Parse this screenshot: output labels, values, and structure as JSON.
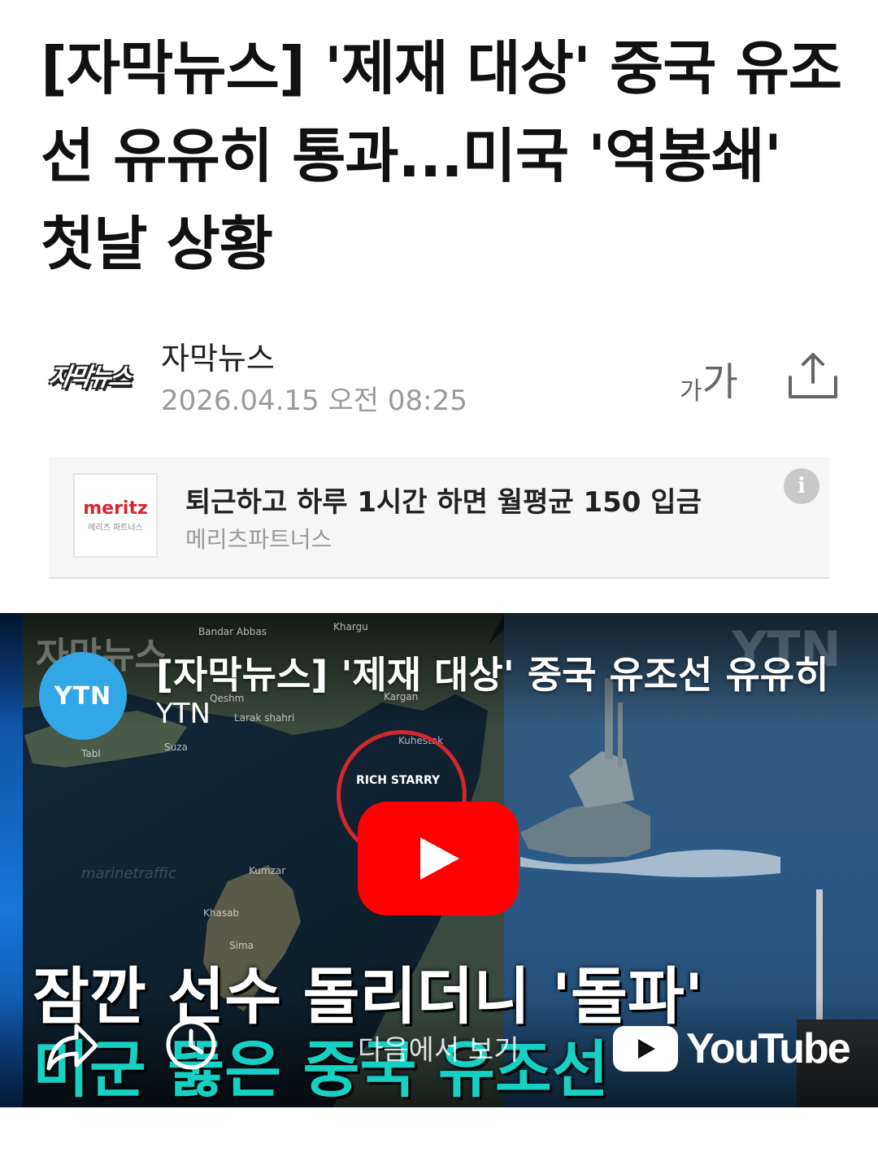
{
  "article": {
    "title": "[자막뉴스] '제재 대상' 중국 유조선 유유히 통과...미국 '역봉쇄' 첫날 상황"
  },
  "byline": {
    "press_logo": "자막뉴스",
    "press_name": "자막뉴스",
    "date": "2026.04.15 오전 08:25",
    "font_small": "가",
    "font_big": "가"
  },
  "ad": {
    "logo_main": "meritz",
    "logo_sub": "메리츠 파트너스",
    "title": "퇴근하고 하루 1시간 하면 월평균 150 입금",
    "sponsor": "메리츠파트너스",
    "info_glyph": "i"
  },
  "video": {
    "channel_avatar": "YTN",
    "title": "[자막뉴스] '제재 대상' 중국 유조선 유유히",
    "channel": "YTN",
    "watermark": "자막뉴스",
    "watermark_ytn": "YTN",
    "ship_tag": "RICH STARRY",
    "marine": "marinetraffic",
    "map_labels": {
      "bandar": "Bandar Abbas",
      "qeshm": "Qeshm",
      "larak": "Larak shahri",
      "suza": "Suza",
      "tabl": "Tabl",
      "kargan": "Kargan",
      "kumzar": "Kumzar",
      "khasab": "Khasab",
      "sima": "Sima",
      "kuhestak": "Kuhestak",
      "khargu": "Khargu"
    },
    "caption_line1": "잠깐 선수 돌리더니 '돌파'",
    "caption_line2": "미군 뚫은 중국 유조선",
    "watch_next": "다음에서 보기",
    "youtube": "YouTube"
  }
}
